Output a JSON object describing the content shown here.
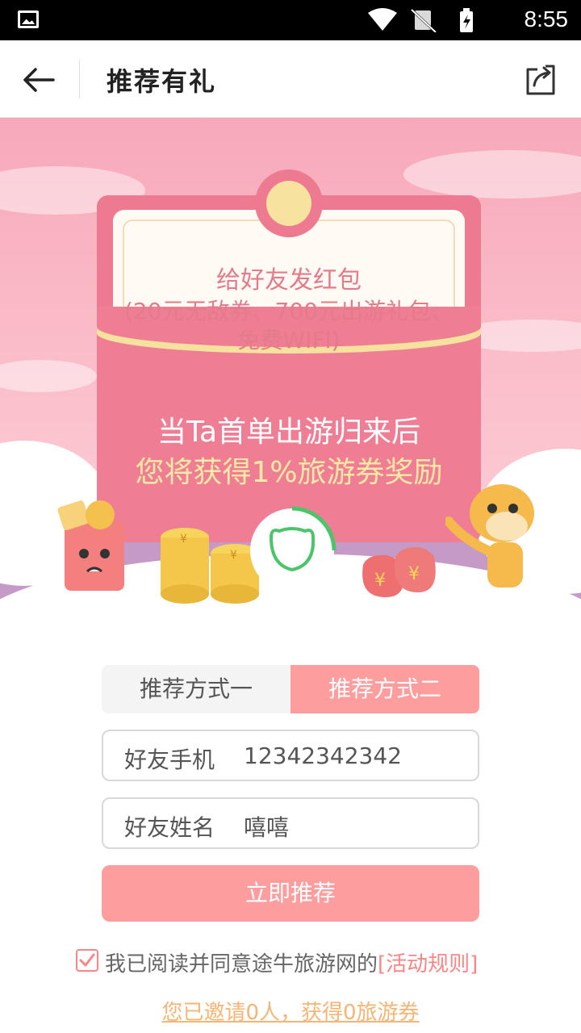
{
  "status_bar": {
    "time": "8:55"
  },
  "header": {
    "title": "推荐有礼",
    "back_icon": "arrow-left-icon",
    "share_icon": "share-icon"
  },
  "banner": {
    "line1": "给好友发红包",
    "line2": "(20元无敌券、700元出游礼包、",
    "line3": "免费WIFI)",
    "line4": "当Ta首单出游归来后",
    "line5": "您将获得1%旅游券奖励",
    "colors": {
      "pink": "#ef7e95",
      "cream": "#fde9a5",
      "purple": "#c59ac7"
    }
  },
  "tabs": {
    "tab1": "推荐方式一",
    "tab2": "推荐方式二",
    "active": "tab2"
  },
  "form": {
    "phone_label": "好友手机",
    "phone_value": "12342342342",
    "name_label": "好友姓名",
    "name_value": "嘻嘻",
    "submit_label": "立即推荐"
  },
  "agreement": {
    "text": "我已阅读并同意途牛旅游网的",
    "link": "[活动规则]",
    "checked": true
  },
  "invite_summary": "您已邀请0人，获得0旅游券"
}
